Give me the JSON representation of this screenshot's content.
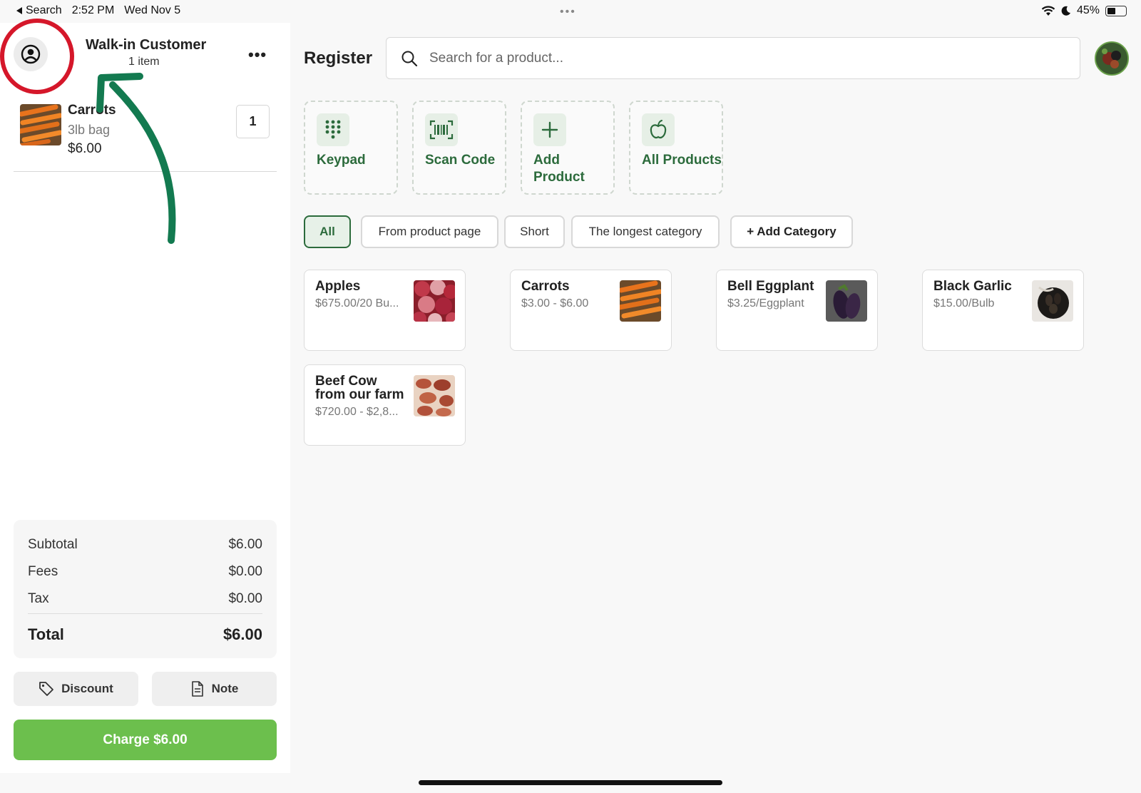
{
  "status_bar": {
    "back_label": "Search",
    "time": "2:52 PM",
    "date": "Wed Nov 5",
    "dots": "•••",
    "battery": "45%"
  },
  "customer": {
    "name": "Walk-in Customer",
    "item_count": "1 item",
    "more": "•••"
  },
  "cart": {
    "items": [
      {
        "name": "Carrots",
        "variant": "3lb bag",
        "price": "$6.00",
        "quantity": "1"
      }
    ]
  },
  "summary": {
    "subtotal_label": "Subtotal",
    "subtotal": "$6.00",
    "fees_label": "Fees",
    "fees": "$0.00",
    "tax_label": "Tax",
    "tax": "$0.00",
    "total_label": "Total",
    "total": "$6.00"
  },
  "actions": {
    "discount": "Discount",
    "note": "Note",
    "charge": "Charge $6.00"
  },
  "header": {
    "title": "Register",
    "search_placeholder": "Search for a product..."
  },
  "tiles": [
    {
      "label": "Keypad",
      "icon": "keypad-icon"
    },
    {
      "label": "Scan Code",
      "icon": "barcode-icon"
    },
    {
      "label": "Add Product",
      "icon": "plus-icon"
    },
    {
      "label": "All Products",
      "icon": "apple-icon"
    }
  ],
  "categories": {
    "items": [
      "All",
      "From product page",
      "Short",
      "The longest category"
    ],
    "selected": "All",
    "add_label": "+ Add Category"
  },
  "products": [
    {
      "name": "Apples",
      "price": "$675.00/20 Bu..."
    },
    {
      "name": "Carrots",
      "price": "$3.00 - $6.00"
    },
    {
      "name": "Bell Eggplant",
      "price": "$3.25/Eggplant"
    },
    {
      "name": "Black Garlic",
      "price": "$15.00/Bulb"
    },
    {
      "name": "Beef Cow from our farm",
      "price": "$720.00 - $2,8..."
    }
  ],
  "colors": {
    "brand_green": "#2c6b3c",
    "charge_green": "#6cbf4d",
    "annotation_red": "#d5172a",
    "annotation_arrow": "#137a50"
  }
}
